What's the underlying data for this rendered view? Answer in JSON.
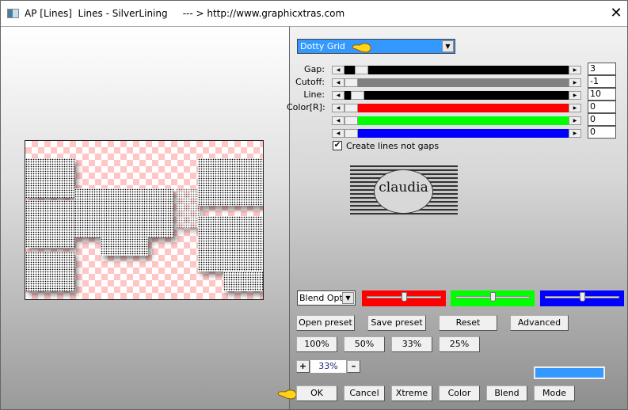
{
  "window": {
    "title": "AP [Lines]  Lines - SilverLining     --- > http://www.graphicxtras.com",
    "close_label": "✕"
  },
  "preset_dropdown": {
    "value": "Dotty Grid"
  },
  "sliders": [
    {
      "label": "Gap:",
      "value": "3",
      "fill_color": "#000000",
      "level": 0.05
    },
    {
      "label": "Cutoff:",
      "value": "-1",
      "fill_color": "#808080",
      "level": 0.0
    },
    {
      "label": "Line:",
      "value": "10",
      "fill_color": "#000000",
      "level": 0.03
    },
    {
      "label": "Color[R]:",
      "value": "0",
      "fill_color": "#ff0000",
      "level": 0.0
    },
    {
      "label": "",
      "value": "0",
      "fill_color": "#00ff00",
      "level": 0.0
    },
    {
      "label": "",
      "value": "0",
      "fill_color": "#0000ff",
      "level": 0.0
    }
  ],
  "checkbox": {
    "label": "Create lines not gaps",
    "checked": true
  },
  "logo": {
    "text": "claudia"
  },
  "blend": {
    "dropdown_value": "Blend Optio",
    "sliders": [
      {
        "color": "#ff0000",
        "level": 0.5
      },
      {
        "color": "#00ff00",
        "level": 0.5
      },
      {
        "color": "#0000ff",
        "level": 0.5
      }
    ]
  },
  "buttons": {
    "open_preset": "Open preset",
    "save_preset": "Save preset",
    "reset": "Reset",
    "advanced": "Advanced",
    "z100": "100%",
    "z50": "50%",
    "z33": "33%",
    "z25": "25%",
    "plus": "+",
    "minus": "–",
    "ok": "OK",
    "cancel": "Cancel",
    "xtreme": "Xtreme",
    "color": "Color",
    "blend": "Blend",
    "mode": "Mode"
  },
  "zoom": {
    "value": "33%"
  },
  "colors": {
    "accent": "#3399ff",
    "swatch": "#3399ff"
  }
}
